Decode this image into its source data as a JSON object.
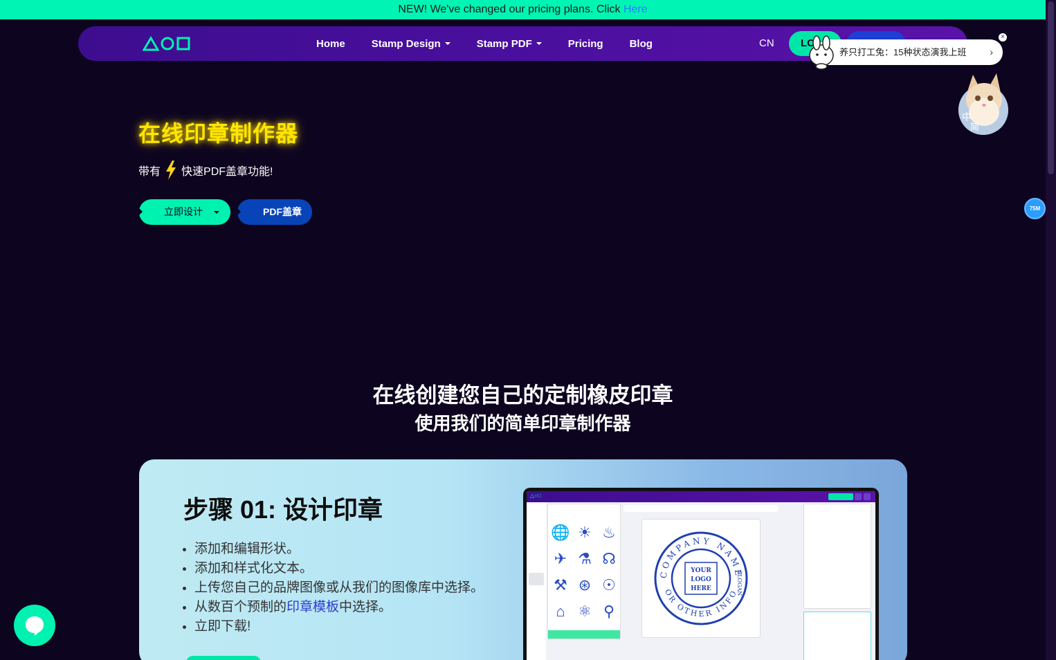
{
  "announcement": {
    "text": "NEW! We've changed our pricing plans. Click ",
    "link": "Here",
    "color": "#00f5b4"
  },
  "nav": {
    "items": [
      {
        "label": "Home"
      },
      {
        "label": "Stamp Design"
      },
      {
        "label": "Stamp PDF"
      },
      {
        "label": "Pricing"
      },
      {
        "label": "Blog"
      }
    ],
    "lang": "CN",
    "login_label": "LO"
  },
  "popup": {
    "text": "养只打工兔：15种状态演我上班",
    "arrow": "›",
    "close": "×"
  },
  "avatar": {
    "label_1": "中",
    "label_2": "简"
  },
  "memory_badge": "75M",
  "hero": {
    "title": "在线印章制作器",
    "subtitle_prefix": "带有",
    "subtitle_suffix": "快速PDF盖章功能!",
    "btn_design": "立即设计",
    "btn_pdf": "PDF盖章"
  },
  "section": {
    "title": "在线创建您自己的定制橡皮印章",
    "subtitle": "使用我们的简单印章制作器"
  },
  "step": {
    "title": "步骤 01: 设计印章",
    "items": [
      "添加和编辑形状。",
      "添加和样式化文本。",
      "上传您自己的品牌图像或从我们的图像库中选择。"
    ],
    "item4_prefix": "从数百个预制的",
    "item4_link": "印章模板",
    "item4_suffix": "中选择。",
    "item5": "立即下载!"
  },
  "mockup": {
    "logo": "△○□",
    "stamp_line_1": "YOUR",
    "stamp_line_2": "LOGO",
    "stamp_line_3": "HERE",
    "stamp_top": "COMPANY NAME",
    "stamp_right": "SLOGAN",
    "stamp_bottom": "OR OTHER INFO"
  },
  "colors": {
    "accent_green": "#00f2b0",
    "brand_purple": "#4a0f9e",
    "title_yellow": "#ffe600",
    "stamp_blue": "#1f3fb0"
  }
}
